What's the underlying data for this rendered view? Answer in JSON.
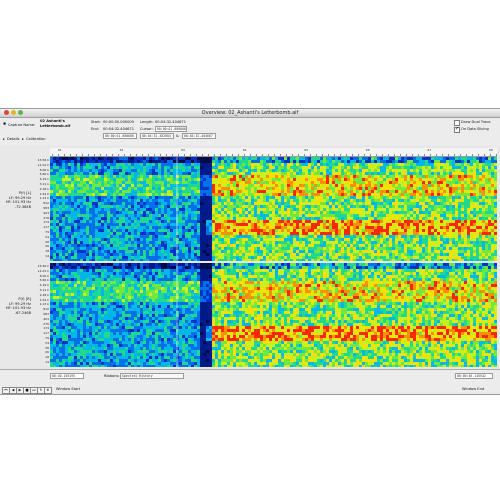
{
  "window": {
    "title": "Overview: 02_Ashanti's Letterbomb.aif"
  },
  "header": {
    "capture_label": "Capture Name:",
    "capture_name_line1": "02 Ashanti's",
    "capture_name_line2": "Letterbomb.aif",
    "start_label": "Start:",
    "start_value": "00:00:00.000000",
    "length_label": "Length:",
    "length_value": "00:04:32.404671",
    "end_label": "End:",
    "end_value": "00:04:32.404671",
    "cursor_label": "Cursor:",
    "field1": "00:00:01.000000",
    "field2": "00:04:32.402004",
    "field3": "00:04:32.404667",
    "amp": "&",
    "draw_dual_trace": "Draw Dual Trace",
    "on_data_slicing": "On Data Slicing",
    "details": "Details",
    "calibration": "Calibration"
  },
  "ruler": {
    "labels": [
      "61",
      "62",
      "63",
      "64",
      "65",
      "66",
      "67",
      "68"
    ]
  },
  "channels": [
    {
      "name": "P(f) [L]",
      "lf": "LF: 99.29 Hz",
      "hf": "HF: 101.93 Hz",
      "value": "-72.3848"
    },
    {
      "name": "P(f) [R]",
      "lf": "LF: 99.29 Hz",
      "hf": "HF: 101.93 Hz",
      "value": "-67.2468"
    }
  ],
  "freq_labels": [
    "15.56 k",
    "11.01 k",
    "8.00 k",
    "5.60 k",
    "4.19 k",
    "3.11 k",
    "2.18 k",
    "1.52 k",
    "1.13 k",
    "810",
    "583",
    "403",
    "276",
    "174",
    "117",
    "79",
    "54",
    "38",
    "26",
    "18",
    "14"
  ],
  "bottom": {
    "start_field": "00:40.150195",
    "ribbons_label": "Ribbons:",
    "ribbons_value": "Spectral History",
    "end_field": "00:00:46.145542",
    "window_start": "Window Start",
    "window_end": "Window End"
  }
}
